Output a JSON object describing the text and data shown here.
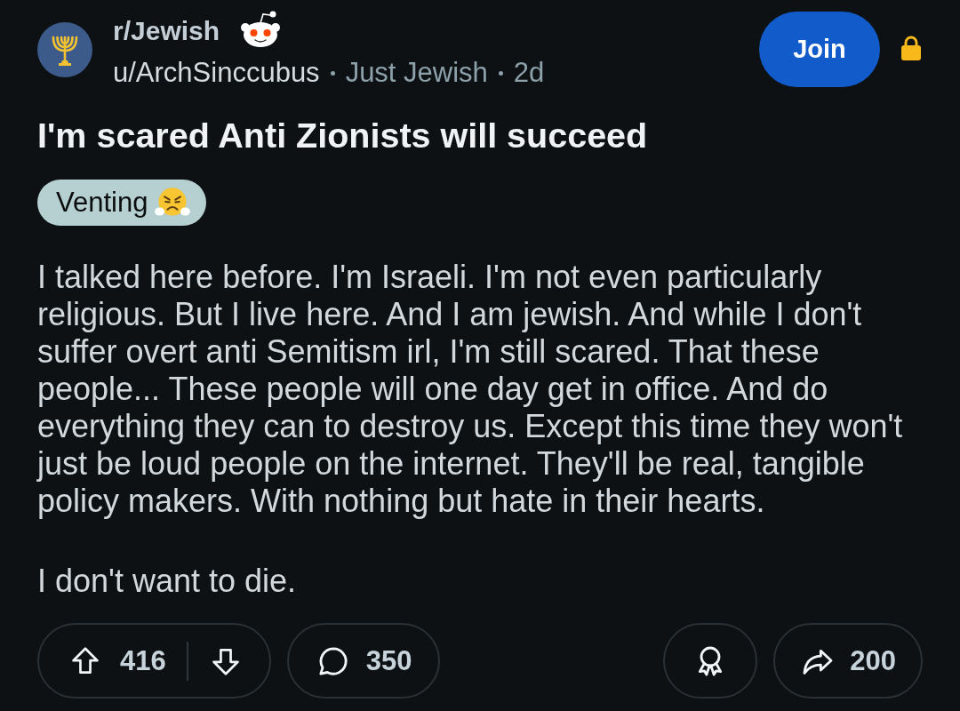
{
  "post": {
    "community": "r/Jewish",
    "author": "u/ArchSinccubus",
    "author_flair": "Just Jewish",
    "age": "2d",
    "join_button": "Join",
    "locked": true,
    "title": "I'm scared Anti Zionists will succeed",
    "flair": "Venting",
    "body": [
      "I talked here before. I'm Israeli. I'm not even particularly religious. But I live here. And I am jewish. And while I don't suffer overt anti Semitism irl, I'm still scared. That these people... These people will one day get in office. And do everything they can to destroy us. Except this time they won't just be loud people on the internet. They'll be real, tangible policy makers. With nothing but hate in their hearts.",
      "I don't want to die."
    ]
  },
  "actions": {
    "upvotes": "416",
    "comments": "350",
    "shares": "200"
  }
}
